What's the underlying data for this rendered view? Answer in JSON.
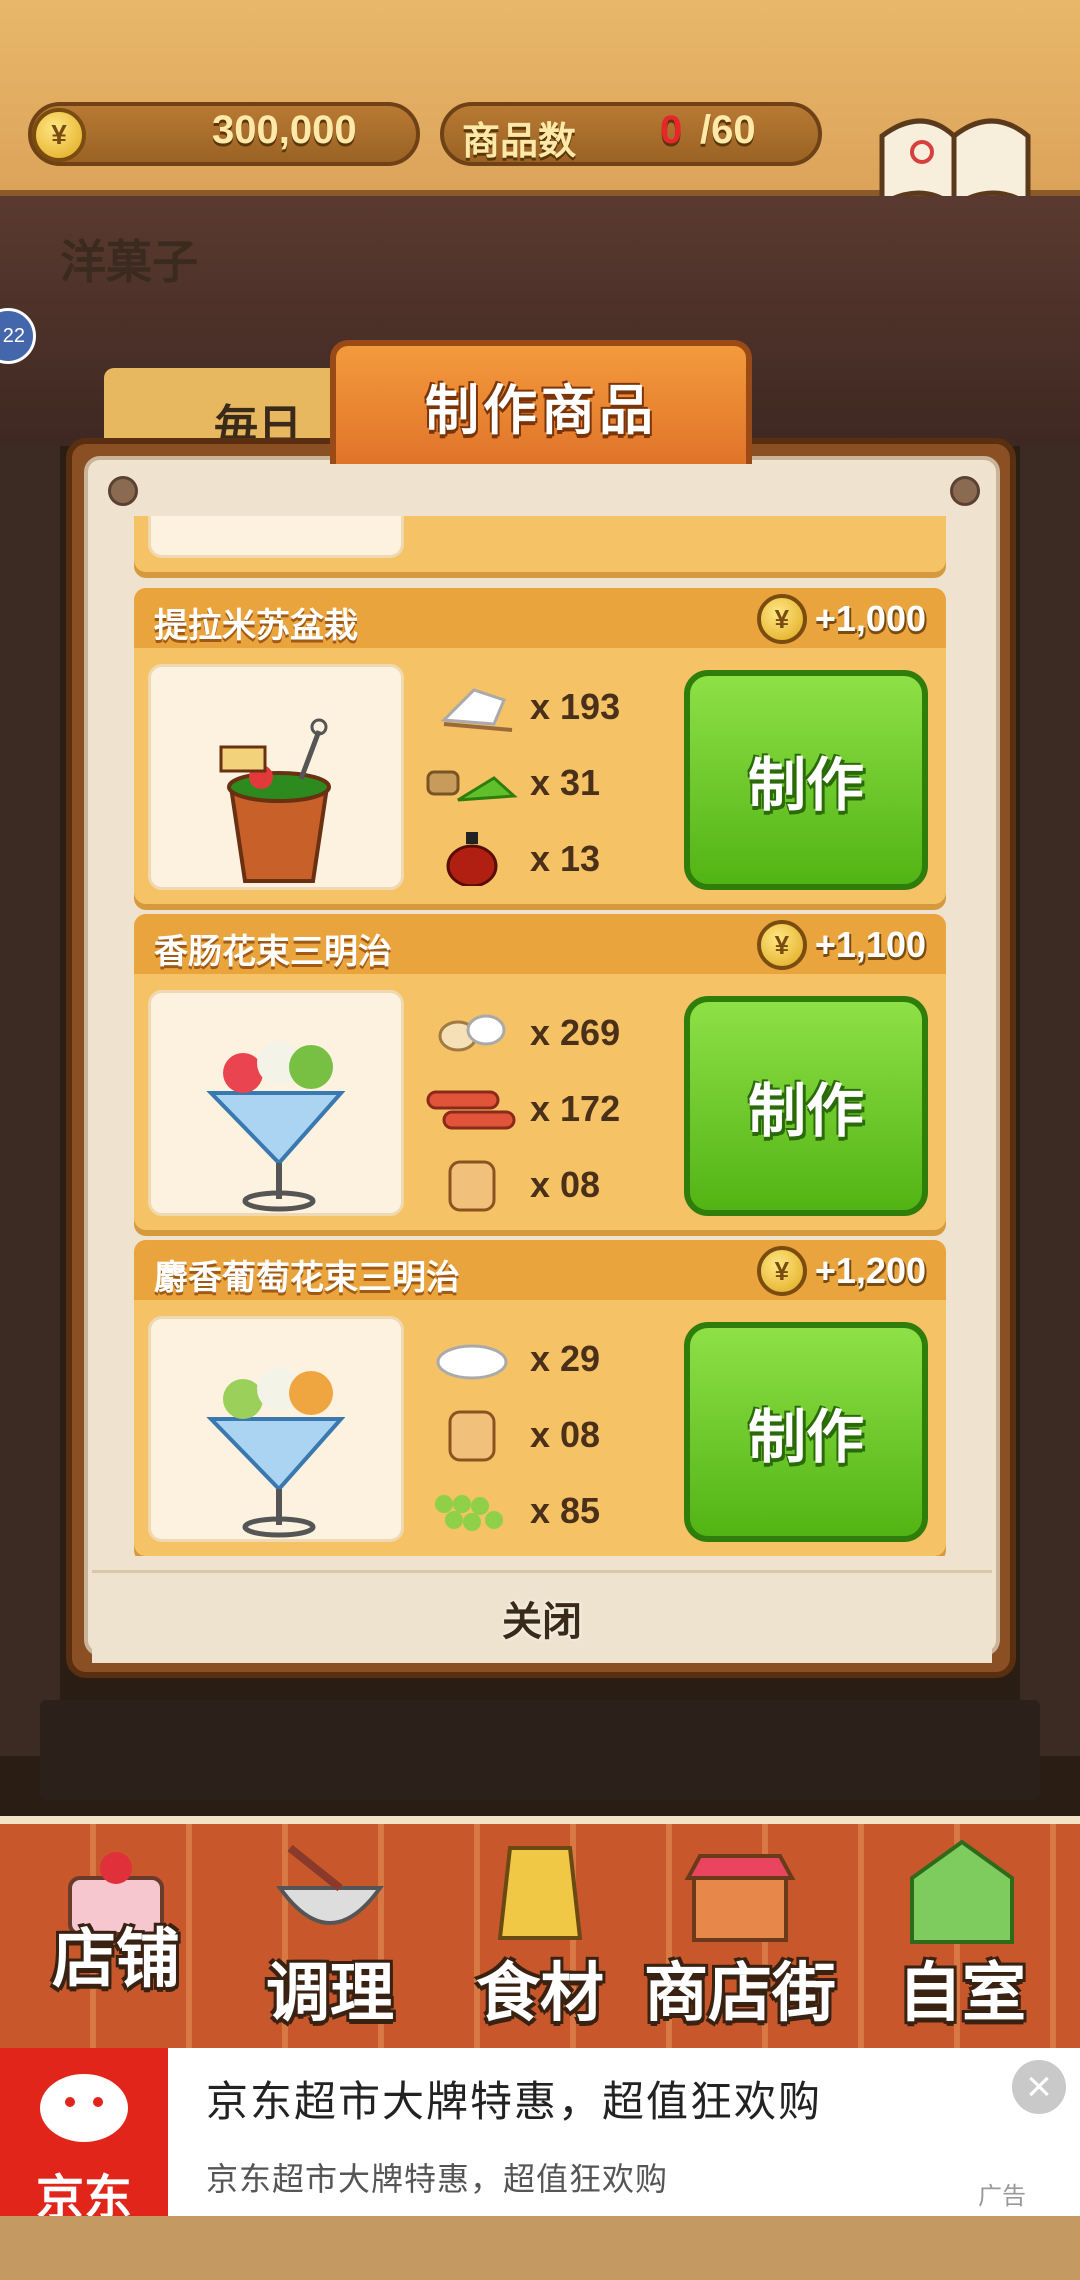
{
  "header": {
    "money": "300,000",
    "currency_symbol": "¥",
    "goods_label": "商品数",
    "goods_count": "0",
    "goods_max": "/60",
    "recipe_label": "食谱"
  },
  "background": {
    "shop_sign": "洋菓子",
    "daily_label": "毎日",
    "side_badge": "22"
  },
  "dialog": {
    "title": "制作商品",
    "close_label": "关闭",
    "items": [
      {
        "name": "提拉米苏盆栽",
        "price": "+1,000",
        "make_label": "制作",
        "ingredients": [
          {
            "icon": "flour-icon",
            "qty": "x 193"
          },
          {
            "icon": "matcha-icon",
            "qty": "x 31"
          },
          {
            "icon": "liqueur-icon",
            "qty": "x 13"
          }
        ]
      },
      {
        "name": "香肠花束三明治",
        "price": "+1,100",
        "make_label": "制作",
        "ingredients": [
          {
            "icon": "eggs-icon",
            "qty": "x 269"
          },
          {
            "icon": "sausage-icon",
            "qty": "x 172"
          },
          {
            "icon": "bread-icon",
            "qty": "x 08"
          }
        ]
      },
      {
        "name": "麝香葡萄花束三明治",
        "price": "+1,200",
        "make_label": "制作",
        "ingredients": [
          {
            "icon": "cream-icon",
            "qty": "x 29"
          },
          {
            "icon": "bread-icon",
            "qty": "x 08"
          },
          {
            "icon": "grapes-icon",
            "qty": "x 85"
          }
        ]
      }
    ]
  },
  "nav": {
    "items": [
      {
        "label": "店铺",
        "icon": "cake-icon"
      },
      {
        "label": "调理",
        "icon": "mixing-bowl-icon"
      },
      {
        "label": "食材",
        "icon": "flour-bag-icon"
      },
      {
        "label": "商店街",
        "icon": "shop-icon"
      },
      {
        "label": "自室",
        "icon": "staff-only-icon"
      }
    ]
  },
  "ad": {
    "brand": "京东",
    "title": "京东超市大牌特惠，超值狂欢购",
    "subtitle": "京东超市大牌特惠，超值狂欢购",
    "tag": "广告",
    "close": "×"
  },
  "colors": {
    "make_button": "#52b414",
    "title_tab": "#e0742a",
    "card": "#f6c266",
    "ad_brand": "#e1251b"
  }
}
